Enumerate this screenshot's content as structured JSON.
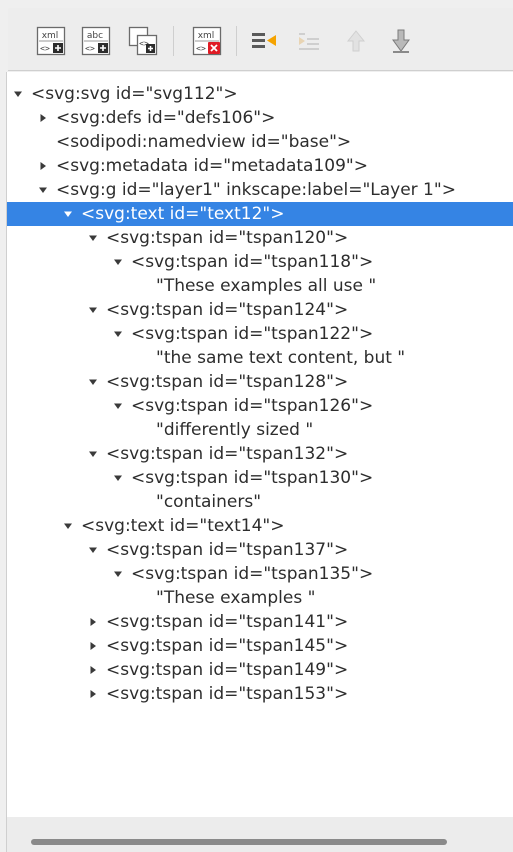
{
  "toolbar": {
    "buttons": [
      {
        "name": "new-element-node-button",
        "icon": "new-element-node-icon",
        "icon_text": "xml"
      },
      {
        "name": "new-text-node-button",
        "icon": "new-text-node-icon",
        "icon_text": "abc"
      },
      {
        "name": "duplicate-node-button",
        "icon": "duplicate-node-icon"
      },
      {
        "name": "delete-node-button",
        "icon": "delete-node-icon",
        "icon_text": "xml"
      },
      {
        "name": "unindent-node-button",
        "icon": "unindent-node-icon"
      },
      {
        "name": "indent-node-button",
        "icon": "indent-node-icon"
      },
      {
        "name": "raise-node-button",
        "icon": "raise-node-icon"
      },
      {
        "name": "lower-node-button",
        "icon": "lower-node-icon"
      }
    ]
  },
  "tree": {
    "nodes": [
      {
        "label": "<svg:svg id=\"svg112\">",
        "expander": "expanded"
      },
      {
        "label": "<svg:defs id=\"defs106\">",
        "expander": "collapsed"
      },
      {
        "label": "<sodipodi:namedview id=\"base\">",
        "expander": "none"
      },
      {
        "label": "<svg:metadata id=\"metadata109\">",
        "expander": "collapsed"
      },
      {
        "label": "<svg:g id=\"layer1\" inkscape:label=\"Layer 1\">",
        "expander": "expanded"
      },
      {
        "label": "<svg:text id=\"text12\">",
        "expander": "expanded",
        "selected": true
      },
      {
        "label": "<svg:tspan id=\"tspan120\">",
        "expander": "expanded"
      },
      {
        "label": "<svg:tspan id=\"tspan118\">",
        "expander": "expanded"
      },
      {
        "label": "\"These examples all use \"",
        "expander": "none"
      },
      {
        "label": "<svg:tspan id=\"tspan124\">",
        "expander": "expanded"
      },
      {
        "label": "<svg:tspan id=\"tspan122\">",
        "expander": "expanded"
      },
      {
        "label": "\"the same text content, but \"",
        "expander": "none"
      },
      {
        "label": "<svg:tspan id=\"tspan128\">",
        "expander": "expanded"
      },
      {
        "label": "<svg:tspan id=\"tspan126\">",
        "expander": "expanded"
      },
      {
        "label": "\"differently sized \"",
        "expander": "none"
      },
      {
        "label": "<svg:tspan id=\"tspan132\">",
        "expander": "expanded"
      },
      {
        "label": "<svg:tspan id=\"tspan130\">",
        "expander": "expanded"
      },
      {
        "label": "\"containers\"",
        "expander": "none"
      },
      {
        "label": "<svg:text id=\"text14\">",
        "expander": "expanded"
      },
      {
        "label": "<svg:tspan id=\"tspan137\">",
        "expander": "expanded"
      },
      {
        "label": "<svg:tspan id=\"tspan135\">",
        "expander": "expanded"
      },
      {
        "label": "\"These examples \"",
        "expander": "none"
      },
      {
        "label": "<svg:tspan id=\"tspan141\">",
        "expander": "collapsed"
      },
      {
        "label": "<svg:tspan id=\"tspan145\">",
        "expander": "collapsed"
      },
      {
        "label": "<svg:tspan id=\"tspan149\">",
        "expander": "collapsed"
      },
      {
        "label": "<svg:tspan id=\"tspan153\">",
        "expander": "collapsed"
      }
    ]
  },
  "colors": {
    "selection": "#3584e4",
    "delete_badge": "#e01b24",
    "add_badge": "#2d2d2d"
  }
}
